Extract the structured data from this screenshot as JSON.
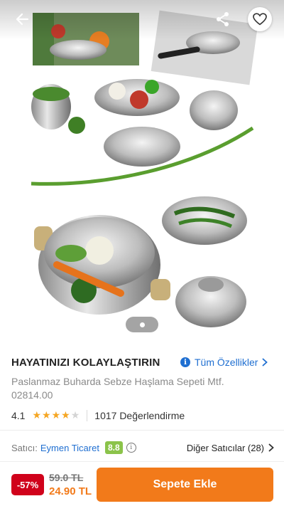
{
  "header": {
    "back_icon": "back-arrow-icon",
    "share_icon": "share-icon",
    "favorite_icon": "heart-icon"
  },
  "gallery": {
    "current_index": 1
  },
  "product": {
    "brand": "HAYATINIZI KOLAYLAŞTIRIN",
    "all_specs_label": "Tüm Özellikler",
    "name": "Paslanmaz Buharda Sebze Haşlama Sepeti Mtf. 02814.00",
    "rating": "4.1",
    "rating_stars": 4.1,
    "reviews": "1017 Değerlendirme"
  },
  "seller": {
    "label": "Satıcı:",
    "name": "Eymen Ticaret",
    "score": "8.8",
    "other_sellers": "Diğer Satıcılar (28)"
  },
  "purchase": {
    "discount": "-57%",
    "old_price": "59.0 TL",
    "new_price": "24.90 TL",
    "add_to_cart": "Sepete Ekle"
  },
  "colors": {
    "accent": "#f27a1a",
    "link": "#1f6fd1",
    "discount": "#d0021b",
    "score": "#8bc34a",
    "star": "#f5a623"
  }
}
